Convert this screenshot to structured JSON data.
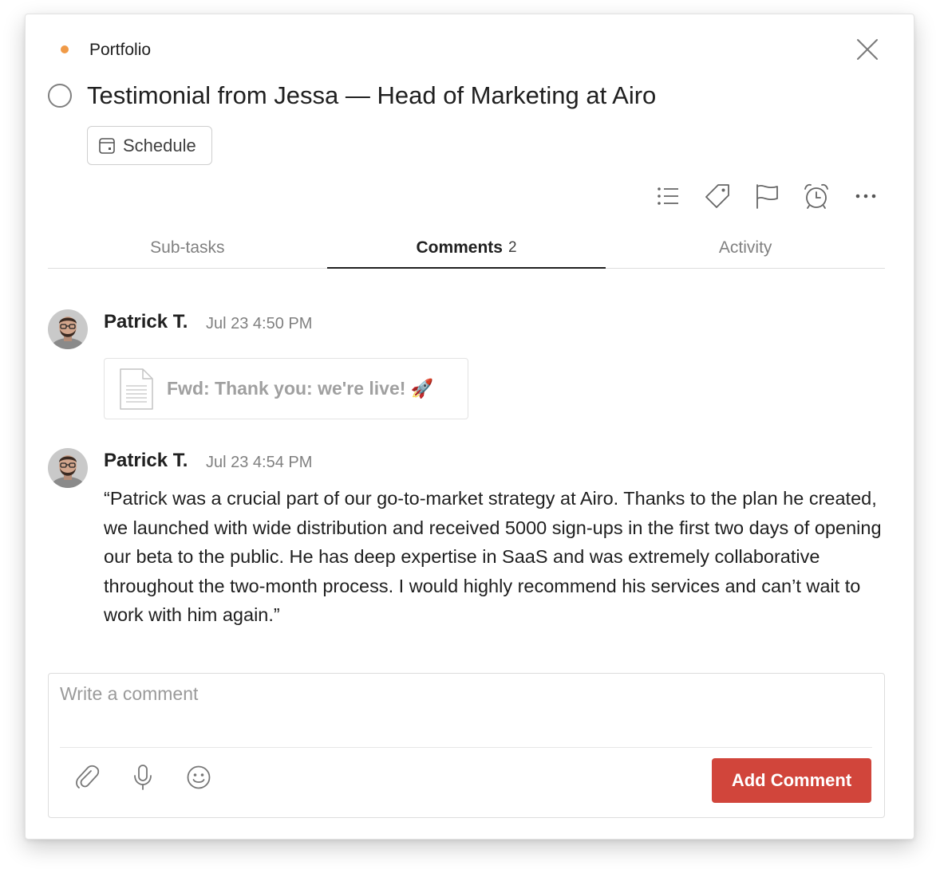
{
  "colors": {
    "project_dot": "#f09a47",
    "accent": "#d1453b"
  },
  "project": {
    "name": "Portfolio"
  },
  "task": {
    "title": "Testimonial from Jessa — Head of Marketing at Airo",
    "schedule_label": "Schedule"
  },
  "toolbar": {
    "icons": [
      "list-icon",
      "tag-icon",
      "flag-icon",
      "alarm-icon",
      "more-icon"
    ]
  },
  "tabs": {
    "subtasks": "Sub-tasks",
    "comments": "Comments",
    "comments_count": "2",
    "activity": "Activity"
  },
  "comments": [
    {
      "author": "Patrick T.",
      "timestamp": "Jul 23 4:50 PM",
      "attachment": "Fwd: Thank you: we're live! 🚀"
    },
    {
      "author": "Patrick T.",
      "timestamp": "Jul 23 4:54 PM",
      "text": "“Patrick was a crucial part of our go-to-market strategy at Airo. Thanks to the plan he created, we launched with wide distribution and received 5000 sign-ups in the first two days of opening our beta to the public. He has deep expertise in SaaS and was extremely collaborative throughout the two-month process. I would highly recommend his services and can’t wait to work with him again.”"
    }
  ],
  "editor": {
    "placeholder": "Write a comment",
    "submit_label": "Add Comment"
  }
}
